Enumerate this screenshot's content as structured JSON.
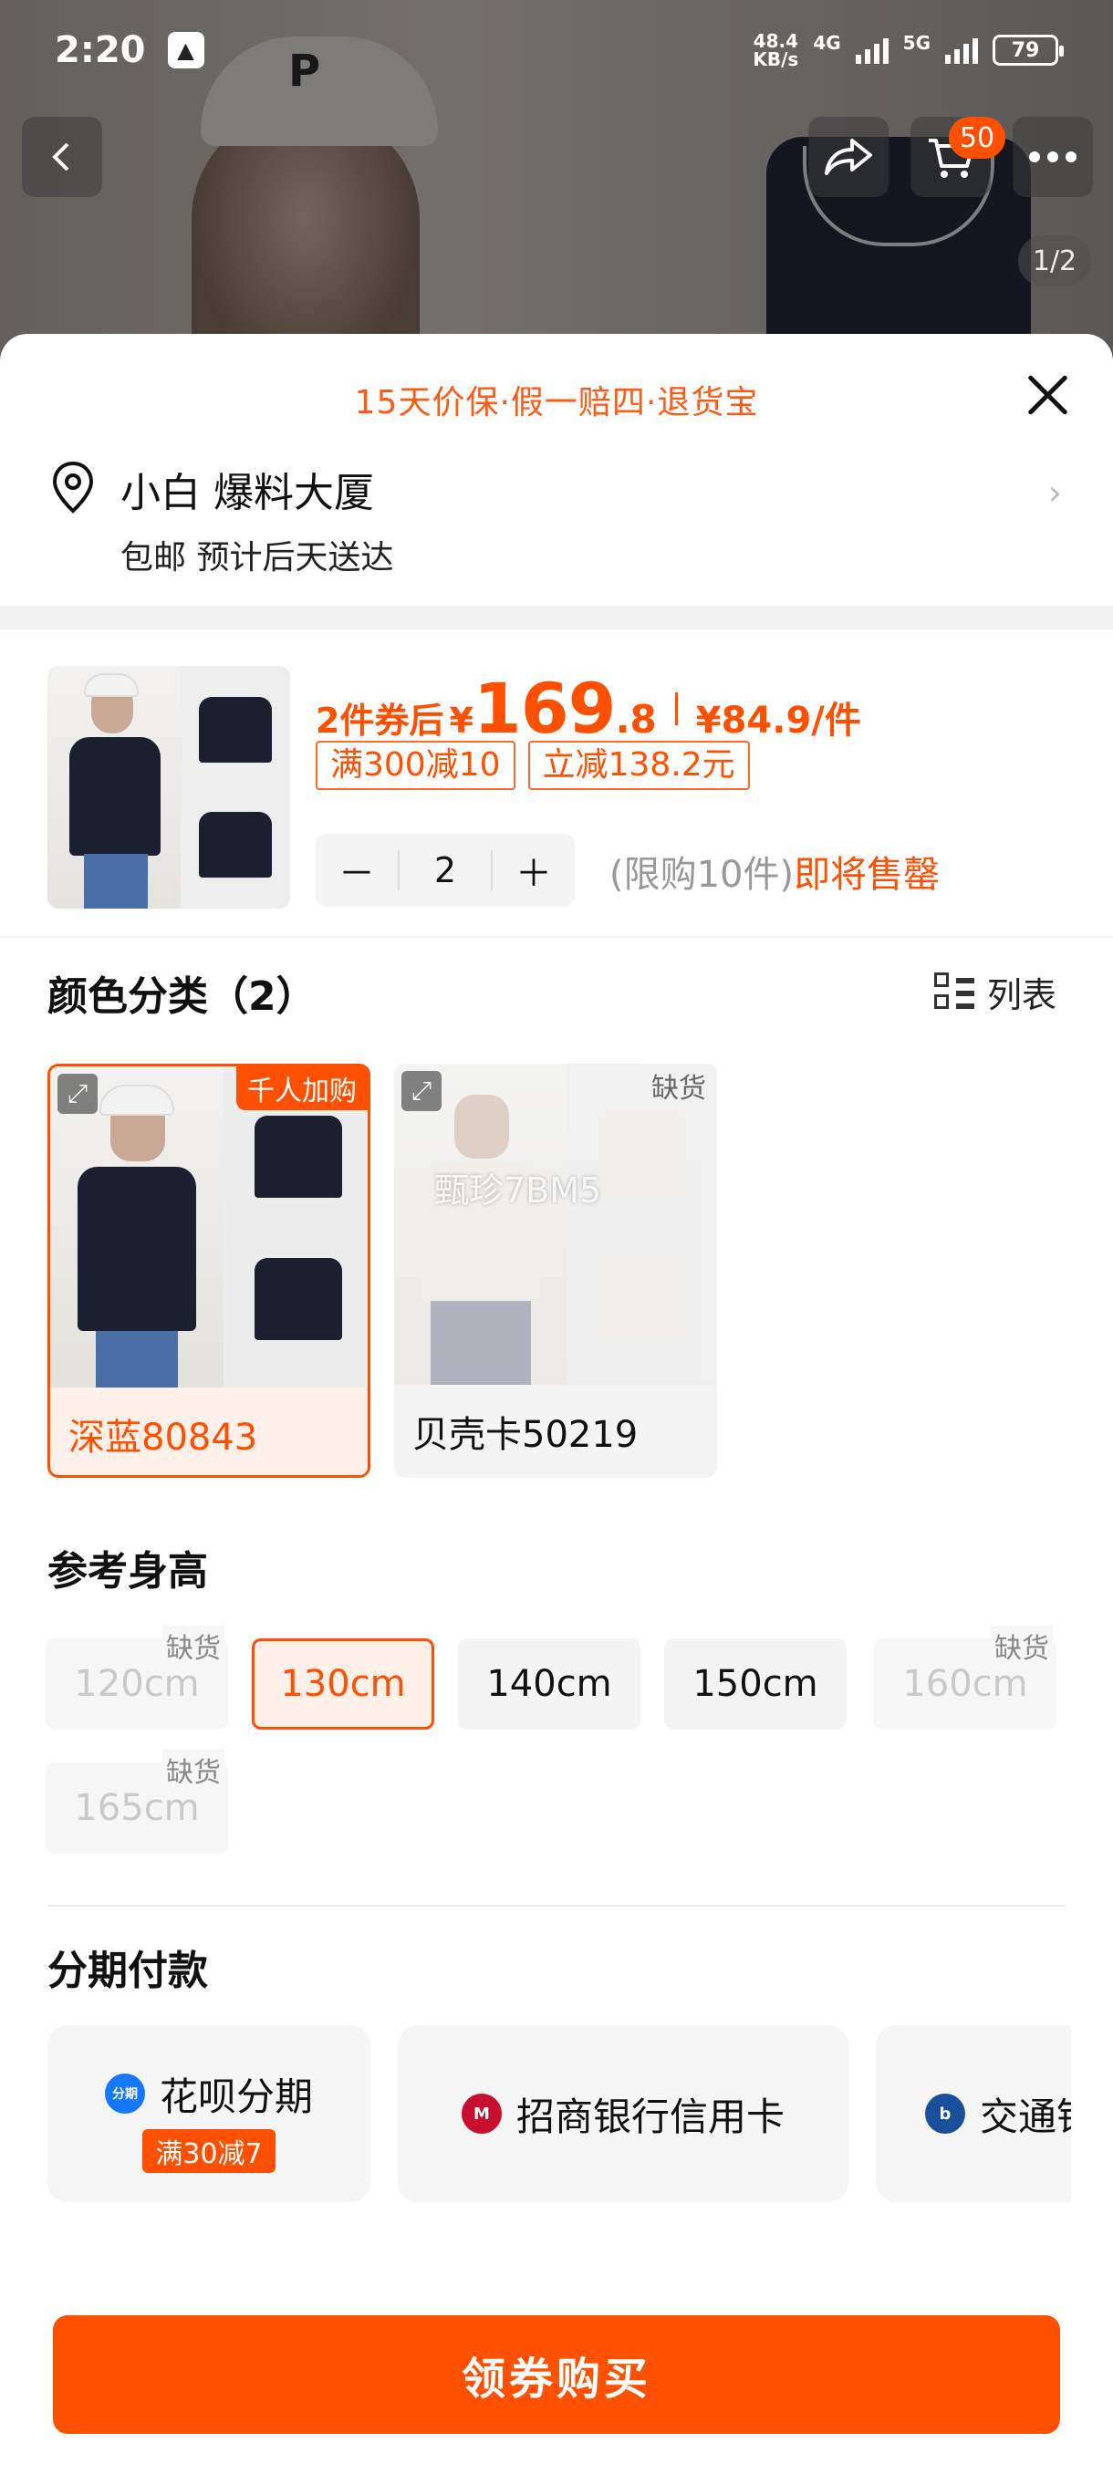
{
  "status_bar": {
    "time": "2:20",
    "net_speed_value": "48.4",
    "net_speed_unit": "KB/s",
    "network_1": "4G",
    "network_2": "5G",
    "battery": "79"
  },
  "header": {
    "cart_count": "50",
    "image_index": "1/2"
  },
  "sheet": {
    "guarantee_text": "15天价保·假一赔四·退货宝",
    "address": {
      "title": "小白 爆料大厦",
      "subtitle": "包邮 预计后天送达"
    },
    "price": {
      "prefix": "2件券后",
      "currency": "¥",
      "integer": "169",
      "decimal": ".8",
      "unit_price": "¥84.9/件"
    },
    "promo_tags": [
      "满300减10",
      "立减138.2元"
    ],
    "quantity": {
      "minus": "－",
      "value": "2",
      "plus": "＋",
      "limit_text": "(限购10件)",
      "stock_text": "即将售罄"
    },
    "color_section": {
      "title": "颜色分类（2）",
      "list_toggle": "列表",
      "options": [
        {
          "name": "深蓝80843",
          "badge": "千人加购",
          "selected": true
        },
        {
          "name": "贝壳卡50219",
          "badge": "缺货",
          "selected": false
        }
      ],
      "watermark": "甄珍7BM5"
    },
    "height_section": {
      "title": "参考身高",
      "options": [
        {
          "label": "120cm",
          "state": "disabled",
          "badge": "缺货"
        },
        {
          "label": "130cm",
          "state": "selected",
          "badge": ""
        },
        {
          "label": "140cm",
          "state": "normal",
          "badge": ""
        },
        {
          "label": "150cm",
          "state": "normal",
          "badge": ""
        },
        {
          "label": "160cm",
          "state": "disabled",
          "badge": "缺货"
        },
        {
          "label": "165cm",
          "state": "disabled",
          "badge": "缺货"
        }
      ]
    },
    "installment": {
      "title": "分期付款",
      "options": [
        {
          "name": "花呗分期",
          "tag": "满30减7",
          "logo_text": "分期",
          "color": "#1677ff"
        },
        {
          "name": "招商银行信用卡",
          "tag": "",
          "logo_text": "M",
          "color": "#c8102e"
        },
        {
          "name": "交通银行",
          "tag": "",
          "logo_text": "b",
          "color": "#1a4f9c"
        }
      ]
    },
    "buy_button": "领券购买"
  },
  "colors": {
    "accent": "#ff5000",
    "accent_light": "#fff1ea"
  }
}
